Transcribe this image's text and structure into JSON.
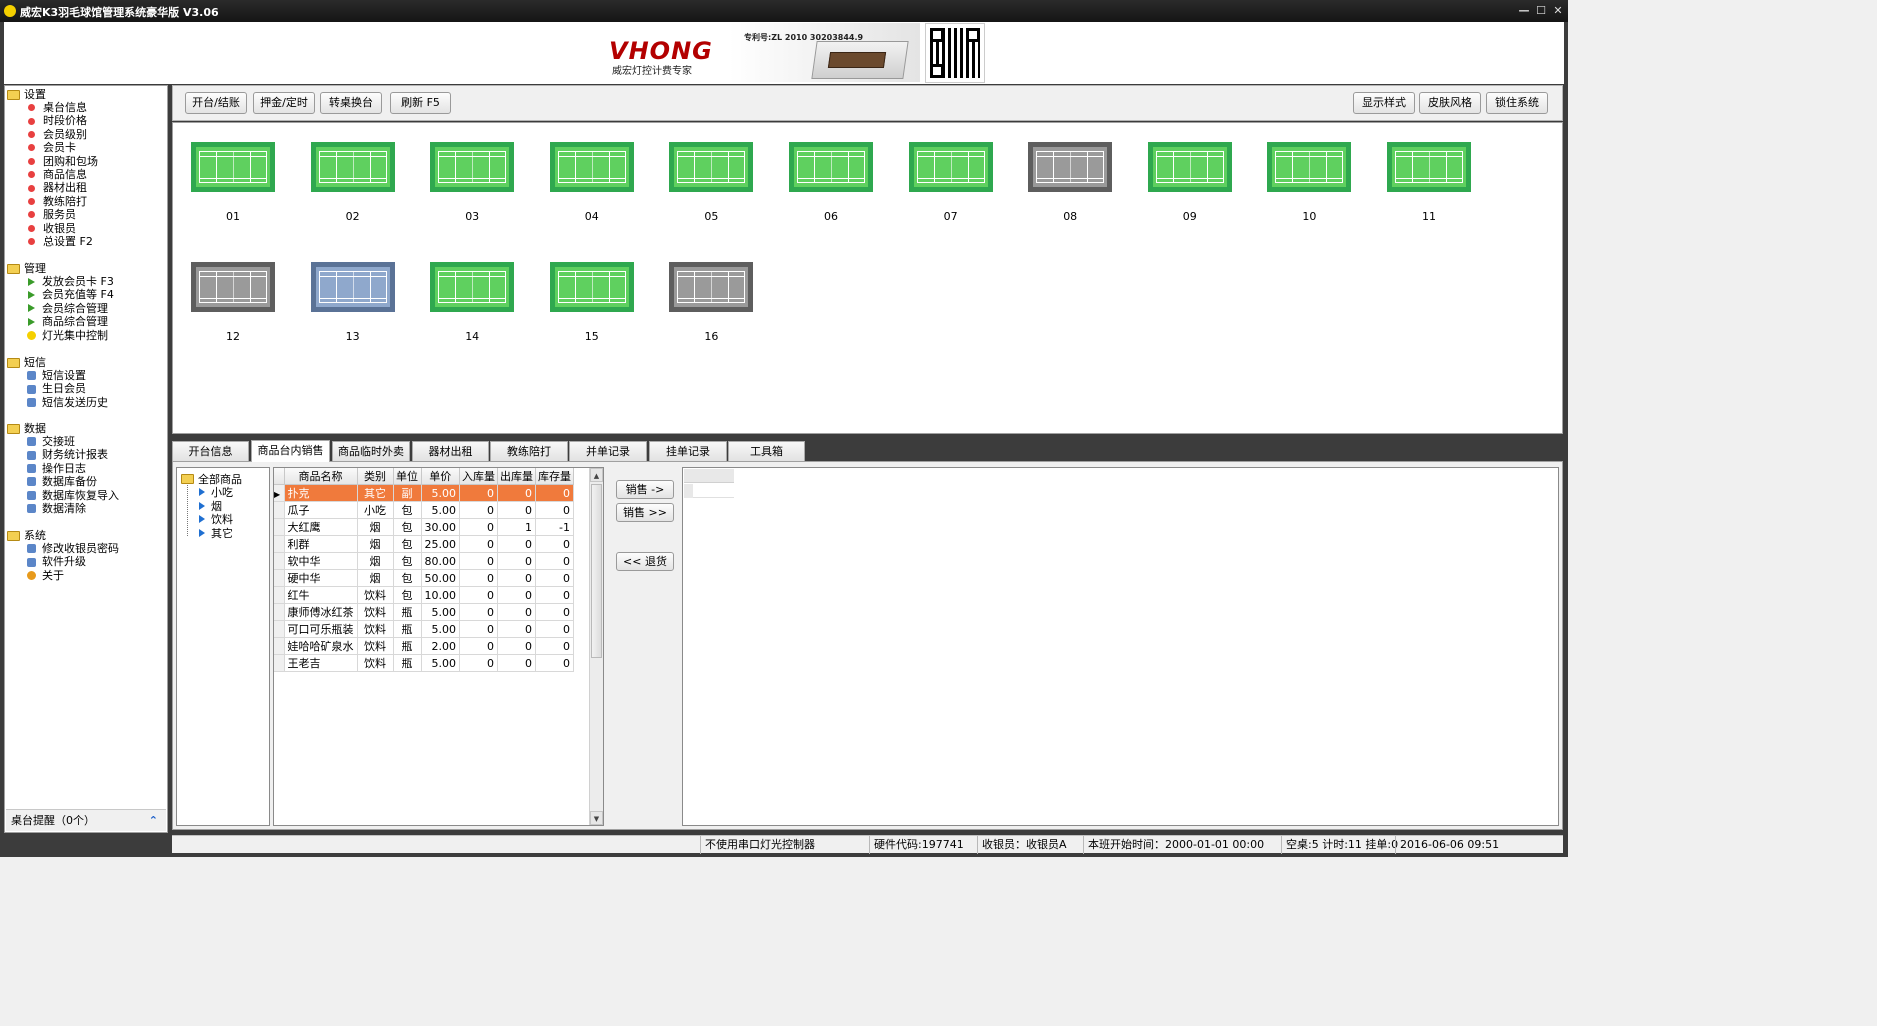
{
  "window": {
    "title": "威宏K3羽毛球馆管理系统豪华版 V3.06"
  },
  "banner": {
    "brand": "VHONG",
    "slogan": "威宏灯控计费专家",
    "patent": "专利号:ZL 2010 30203844.9"
  },
  "sidebar": {
    "groups": [
      {
        "label": "设置",
        "items": [
          {
            "label": "桌台信息",
            "icon": "red-dot-icon"
          },
          {
            "label": "时段价格",
            "icon": "red-dot-icon"
          },
          {
            "label": "会员级别",
            "icon": "red-dot-icon"
          },
          {
            "label": "会员卡",
            "icon": "red-dot-icon"
          },
          {
            "label": "团购和包场",
            "icon": "red-dot-icon"
          },
          {
            "label": "商品信息",
            "icon": "red-dot-icon"
          },
          {
            "label": "器材出租",
            "icon": "red-dot-icon"
          },
          {
            "label": "教练陪打",
            "icon": "red-dot-icon"
          },
          {
            "label": "服务员",
            "icon": "red-dot-icon"
          },
          {
            "label": "收银员",
            "icon": "red-dot-icon"
          },
          {
            "label": "总设置 F2",
            "icon": "red-dot-icon"
          }
        ]
      },
      {
        "label": "管理",
        "items": [
          {
            "label": "发放会员卡 F3",
            "icon": "green-arrow-icon"
          },
          {
            "label": "会员充值等 F4",
            "icon": "green-arrow-icon"
          },
          {
            "label": "会员综合管理",
            "icon": "green-arrow-icon"
          },
          {
            "label": "商品综合管理",
            "icon": "green-arrow-icon"
          },
          {
            "label": "灯光集中控制",
            "icon": "light-bulb-icon"
          }
        ]
      },
      {
        "label": "短信",
        "items": [
          {
            "label": "短信设置",
            "icon": "tools-icon"
          },
          {
            "label": "生日会员",
            "icon": "contacts-icon"
          },
          {
            "label": "短信发送历史",
            "icon": "contacts-icon"
          }
        ]
      },
      {
        "label": "数据",
        "items": [
          {
            "label": "交接班",
            "icon": "shift-icon"
          },
          {
            "label": "财务统计报表",
            "icon": "report-icon"
          },
          {
            "label": "操作日志",
            "icon": "log-icon"
          },
          {
            "label": "数据库备份",
            "icon": "database-icon"
          },
          {
            "label": "数据库恢复导入",
            "icon": "database-icon"
          },
          {
            "label": "数据清除",
            "icon": "clear-data-icon"
          }
        ]
      },
      {
        "label": "系统",
        "items": [
          {
            "label": "修改收银员密码",
            "icon": "key-icon"
          },
          {
            "label": "软件升级",
            "icon": "lightning-icon"
          },
          {
            "label": "关于",
            "icon": "about-icon"
          }
        ]
      }
    ],
    "reminder": "桌台提醒（0个）"
  },
  "toolbar": {
    "left": [
      "开台/结账",
      "押金/定时",
      "转桌换台",
      "刷新 F5"
    ],
    "right": [
      "显示样式",
      "皮肤风格",
      "锁住系统"
    ]
  },
  "courts": [
    {
      "label": "01",
      "state": "available"
    },
    {
      "label": "02",
      "state": "available"
    },
    {
      "label": "03",
      "state": "available"
    },
    {
      "label": "04",
      "state": "available"
    },
    {
      "label": "05",
      "state": "available"
    },
    {
      "label": "06",
      "state": "available"
    },
    {
      "label": "07",
      "state": "available"
    },
    {
      "label": "08",
      "state": "off"
    },
    {
      "label": "09",
      "state": "available"
    },
    {
      "label": "10",
      "state": "available"
    },
    {
      "label": "11",
      "state": "available"
    },
    {
      "label": "12",
      "state": "off"
    },
    {
      "label": "13",
      "state": "reserved"
    },
    {
      "label": "14",
      "state": "available"
    },
    {
      "label": "15",
      "state": "available"
    },
    {
      "label": "16",
      "state": "off"
    }
  ],
  "tabs": [
    "开台信息",
    "商品台内销售",
    "商品临时外卖",
    "器材出租",
    "教练陪打",
    "并单记录",
    "挂单记录",
    "工具箱"
  ],
  "active_tab": 1,
  "categories": {
    "root": "全部商品",
    "children": [
      "小吃",
      "烟",
      "饮料",
      "其它"
    ]
  },
  "product_table": {
    "columns": [
      "商品名称",
      "类别",
      "单位",
      "单价",
      "入库量",
      "出库量",
      "库存量"
    ],
    "rows": [
      [
        "扑克",
        "其它",
        "副",
        "5.00",
        "0",
        "0",
        "0"
      ],
      [
        "瓜子",
        "小吃",
        "包",
        "5.00",
        "0",
        "0",
        "0"
      ],
      [
        "大红鹰",
        "烟",
        "包",
        "30.00",
        "0",
        "1",
        "-1"
      ],
      [
        "利群",
        "烟",
        "包",
        "25.00",
        "0",
        "0",
        "0"
      ],
      [
        "软中华",
        "烟",
        "包",
        "80.00",
        "0",
        "0",
        "0"
      ],
      [
        "硬中华",
        "烟",
        "包",
        "50.00",
        "0",
        "0",
        "0"
      ],
      [
        "红牛",
        "饮料",
        "包",
        "10.00",
        "0",
        "0",
        "0"
      ],
      [
        "康师傅冰红茶",
        "饮料",
        "瓶",
        "5.00",
        "0",
        "0",
        "0"
      ],
      [
        "可口可乐瓶装",
        "饮料",
        "瓶",
        "5.00",
        "0",
        "0",
        "0"
      ],
      [
        "娃哈哈矿泉水",
        "饮料",
        "瓶",
        "2.00",
        "0",
        "0",
        "0"
      ],
      [
        "王老吉",
        "饮料",
        "瓶",
        "5.00",
        "0",
        "0",
        "0"
      ]
    ],
    "selected_row": 0
  },
  "actions": {
    "sell_one": "销售 ->",
    "sell_all": "销售 >>",
    "return": "<< 退货"
  },
  "status": {
    "serial": "不使用串口灯光控制器",
    "hw_code": "硬件代码:197741",
    "cashier": "收银员：收银员A",
    "shift_start": "本班开始时间：2000-01-01 00:00",
    "counts": "空桌:5 计时:11 挂单:0",
    "datetime": "2016-06-06 09:51"
  }
}
